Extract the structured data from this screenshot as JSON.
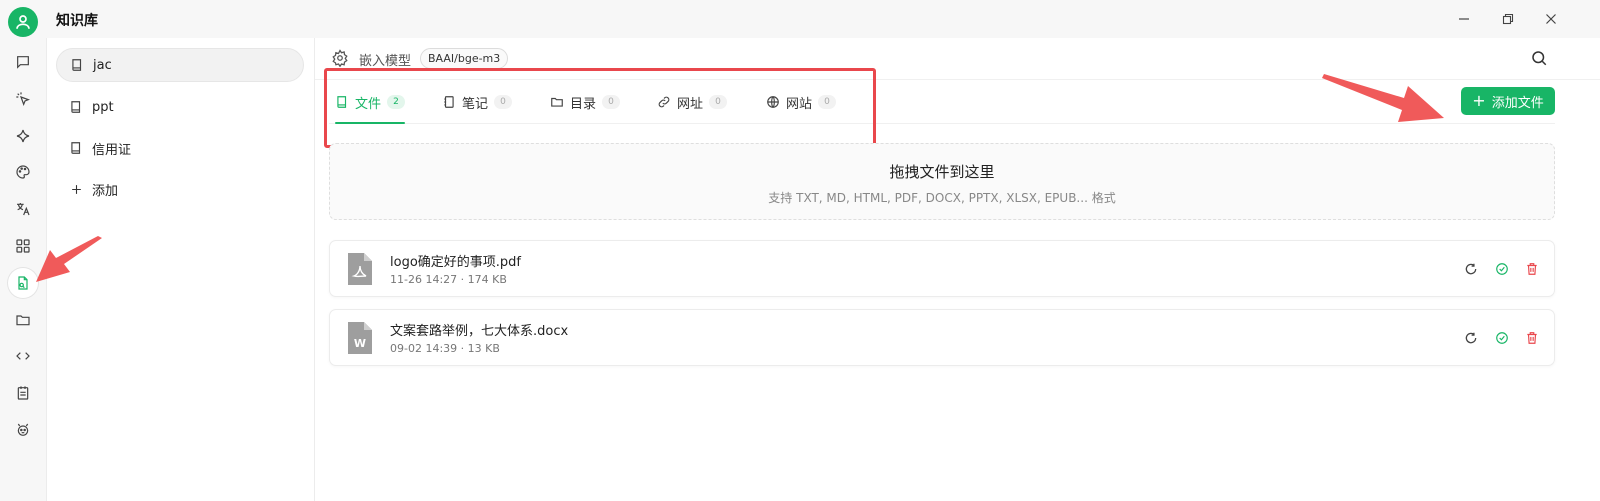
{
  "app": {
    "title": "知识库"
  },
  "colors": {
    "accent": "#18b566",
    "danger": "#e9474c",
    "annotation": "#f05a5a"
  },
  "rail": {
    "items": [
      {
        "name": "chat-icon"
      },
      {
        "name": "agent-pointer-icon"
      },
      {
        "name": "sparkle-icon"
      },
      {
        "name": "palette-icon"
      },
      {
        "name": "translate-icon"
      },
      {
        "name": "apps-grid-icon"
      },
      {
        "name": "knowledge-base-icon",
        "active": true
      },
      {
        "name": "folder-icon"
      },
      {
        "name": "code-icon"
      },
      {
        "name": "notes-icon"
      },
      {
        "name": "robot-icon"
      }
    ]
  },
  "kb_list": {
    "items": [
      {
        "label": "jac",
        "active": true
      },
      {
        "label": "ppt"
      },
      {
        "label": "信用证"
      }
    ],
    "add_label": "添加"
  },
  "topbar": {
    "embed_label": "嵌入模型",
    "model": "BAAI/bge-m3"
  },
  "tabs": [
    {
      "label": "文件",
      "count": "2",
      "icon": "book-icon",
      "active": true
    },
    {
      "label": "笔记",
      "count": "0",
      "icon": "notebook-icon"
    },
    {
      "label": "目录",
      "count": "0",
      "icon": "folder-icon"
    },
    {
      "label": "网址",
      "count": "0",
      "icon": "link-icon"
    },
    {
      "label": "网站",
      "count": "0",
      "icon": "globe-icon"
    }
  ],
  "add_file_button": "添加文件",
  "dropzone": {
    "title": "拖拽文件到这里",
    "subtitle": "支持 TXT, MD, HTML, PDF, DOCX, PPTX, XLSX, EPUB... 格式"
  },
  "files": [
    {
      "name": "logo确定好的事项.pdf",
      "meta": "11-26 14:27 · 174 KB",
      "type": "pdf"
    },
    {
      "name": "文案套路举例，七大体系.docx",
      "meta": "09-02 14:39 · 13 KB",
      "type": "docx",
      "type_letter": "W"
    }
  ]
}
